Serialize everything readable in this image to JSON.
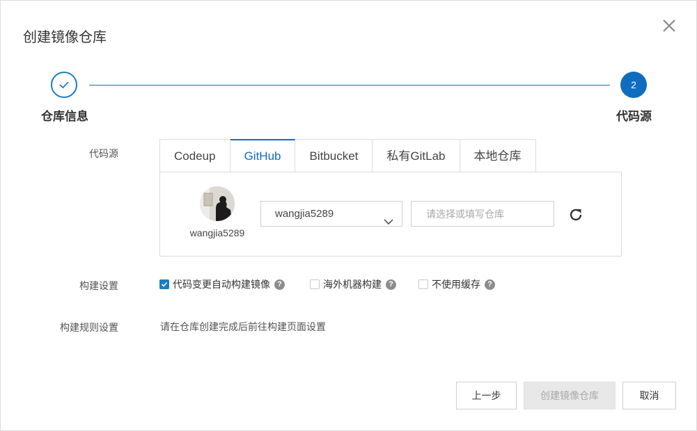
{
  "dialog": {
    "title": "创建镜像仓库"
  },
  "steps": [
    {
      "label": "仓库信息",
      "state": "done"
    },
    {
      "label": "代码源",
      "number": "2",
      "state": "active"
    }
  ],
  "form": {
    "source_label": "代码源",
    "build_settings_label": "构建设置",
    "build_rules_label": "构建规则设置",
    "build_rules_text": "请在仓库创建完成后前往构建页面设置"
  },
  "tabs": [
    {
      "label": "Codeup",
      "active": false
    },
    {
      "label": "GitHub",
      "active": true
    },
    {
      "label": "Bitbucket",
      "active": false
    },
    {
      "label": "私有GitLab",
      "active": false
    },
    {
      "label": "本地仓库",
      "active": false
    }
  ],
  "account": {
    "username": "wangjia5289",
    "selected_namespace": "wangjia5289",
    "repo_placeholder": "请选择或填写仓库",
    "repo_value": ""
  },
  "build_options": [
    {
      "label": "代码变更自动构建镜像",
      "checked": true,
      "help": "?"
    },
    {
      "label": "海外机器构建",
      "checked": false,
      "help": "?"
    },
    {
      "label": "不使用缓存",
      "checked": false,
      "help": "?"
    }
  ],
  "footer": {
    "prev_label": "上一步",
    "create_label": "创建镜像仓库",
    "cancel_label": "取消"
  },
  "colors": {
    "accent": "#0f6cbf",
    "step_line": "#1a6fa8",
    "disabled_bg": "#e8e8e8"
  },
  "icons": {
    "close": "close-icon",
    "check": "check-icon",
    "caret": "chevron-down-icon",
    "refresh": "refresh-icon",
    "help": "help-icon"
  }
}
